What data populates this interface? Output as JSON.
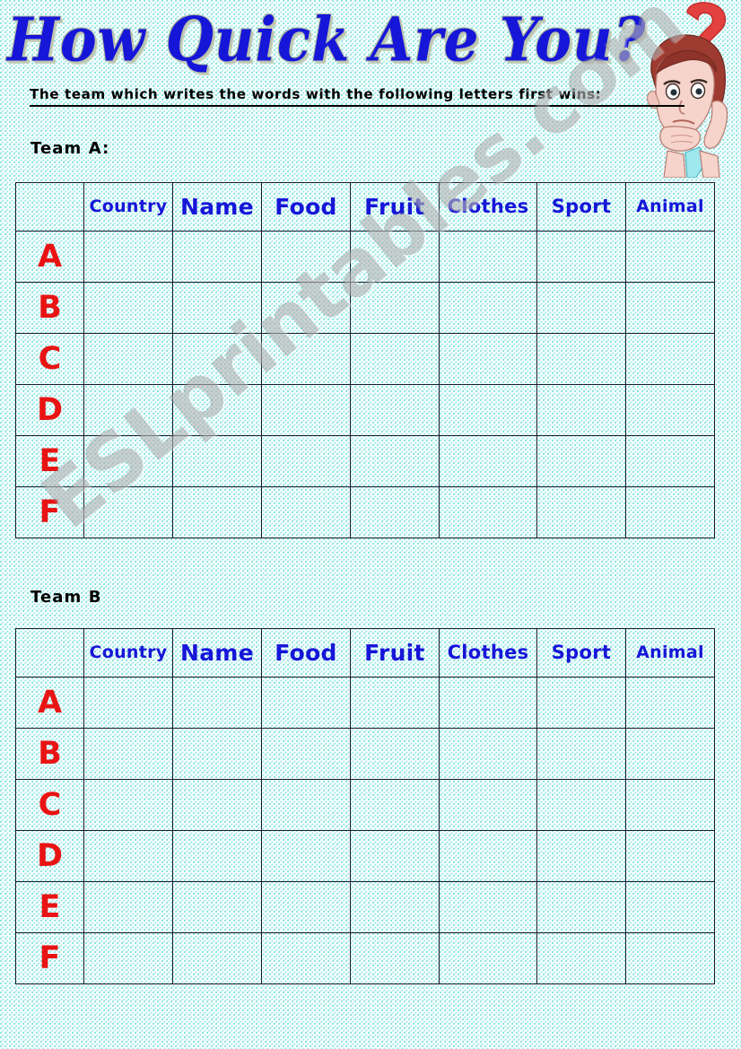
{
  "worksheet": {
    "title": "How Quick Are You?",
    "instruction": "The team which writes the words with the following letters first wins:",
    "watermark": "ESLprintables.com",
    "colors": {
      "title_blue": "#1616d8",
      "header_orange": "#ffbe0a",
      "header_green": "#8dce54",
      "letter_red": "#e81414",
      "grid_line": "#1a1a2e",
      "paper_teal": "#40d2cd"
    }
  },
  "illustration": {
    "name": "thinking-boy-with-question-mark",
    "question_mark_color": "#e2413f",
    "hair_color": "#9e3b30",
    "skin_color": "#f6d4cb",
    "collar_color": "#9fe8ee"
  },
  "columns": [
    {
      "label": "Country",
      "size": "sm"
    },
    {
      "label": "Name",
      "size": "lg"
    },
    {
      "label": "Food",
      "size": "lg"
    },
    {
      "label": "Fruit",
      "size": "lg"
    },
    {
      "label": "Clothes",
      "size": "md"
    },
    {
      "label": "Sport",
      "size": "md"
    },
    {
      "label": "Animal",
      "size": "sm"
    }
  ],
  "rows": [
    "A",
    "B",
    "C",
    "D",
    "E",
    "F"
  ],
  "teams": [
    {
      "id": "team-a",
      "label": "Team A:",
      "header_style": "hdr-a",
      "header_color": "#ffbe0a"
    },
    {
      "id": "team-b",
      "label": "Team B",
      "header_style": "hdr-b",
      "header_color": "#8dce54"
    }
  ]
}
